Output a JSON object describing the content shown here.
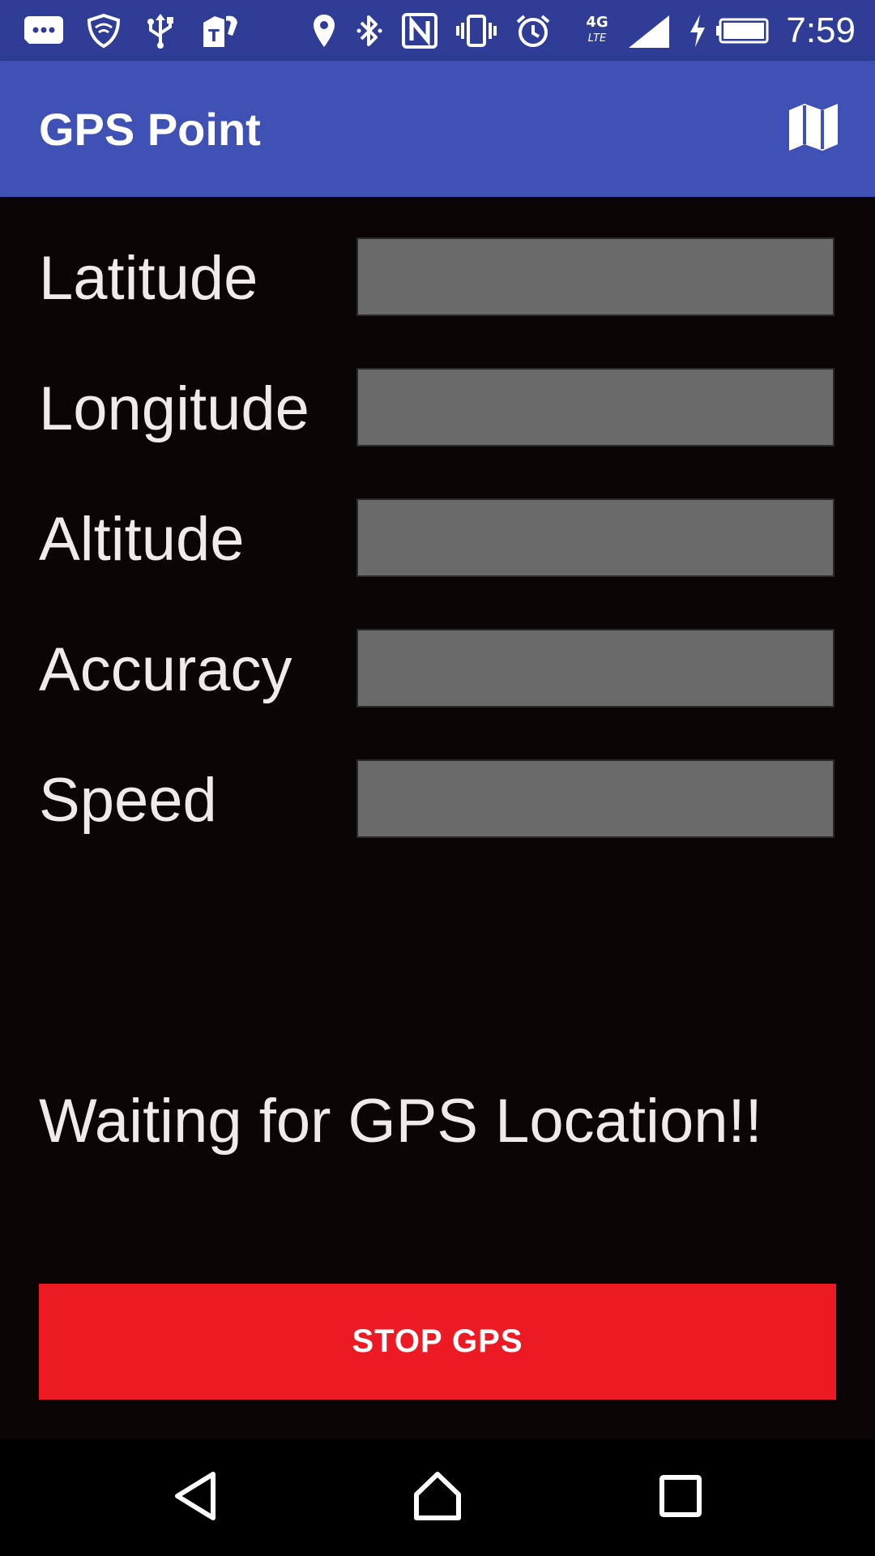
{
  "status_bar": {
    "time": "7:59",
    "network": "4G LTE",
    "icons": [
      "message-icon",
      "vpn-shield-icon",
      "usb-icon",
      "tmobile-icon",
      "location-icon",
      "bluetooth-icon",
      "nfc-icon",
      "vibrate-icon",
      "alarm-icon",
      "lte-icon",
      "signal-icon",
      "charging-icon",
      "battery-icon"
    ]
  },
  "app_bar": {
    "title": "GPS Point",
    "action_icon": "map-icon"
  },
  "fields": [
    {
      "label": "Latitude",
      "value": ""
    },
    {
      "label": "Longitude",
      "value": ""
    },
    {
      "label": "Altitude",
      "value": ""
    },
    {
      "label": "Accuracy",
      "value": ""
    },
    {
      "label": "Speed",
      "value": ""
    }
  ],
  "status_message": "Waiting for GPS Location!!",
  "stop_button": {
    "label": "STOP GPS"
  },
  "colors": {
    "status_bar": "#2f3d97",
    "app_bar": "#4051b5",
    "background": "#0b0506",
    "input_bg": "#6b6a6a",
    "stop_button": "#ec1b23"
  },
  "nav_bar": {
    "icons": [
      "back-icon",
      "home-icon",
      "recents-icon"
    ]
  }
}
